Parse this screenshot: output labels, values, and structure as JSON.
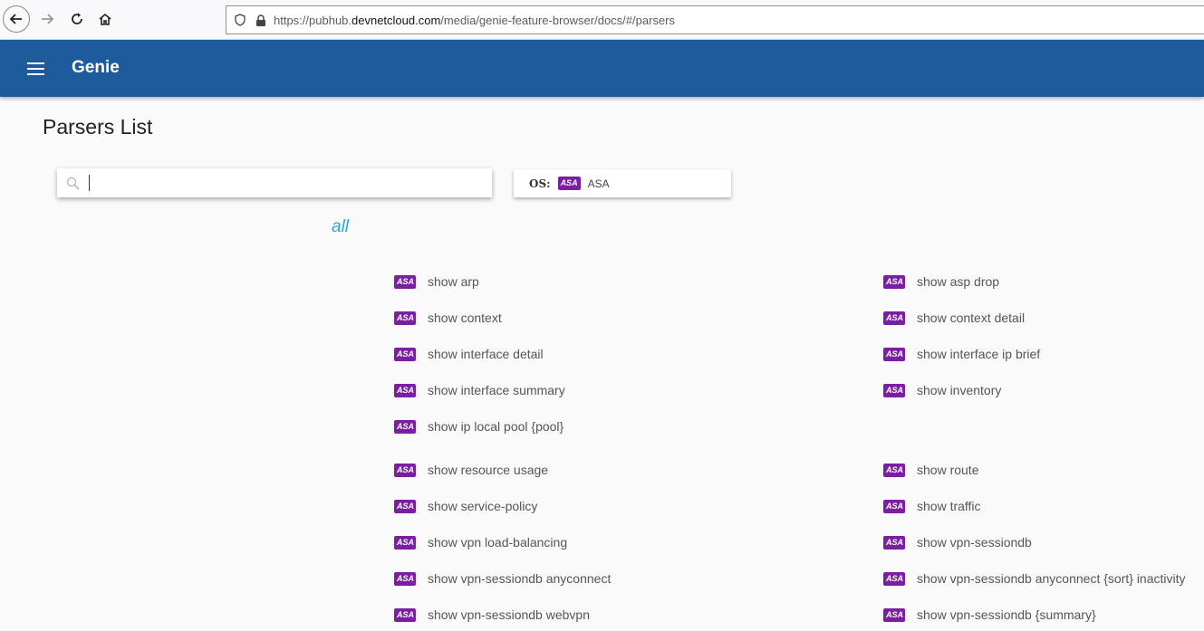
{
  "browser": {
    "url_prefix": "https://pubhub.",
    "url_domain": "devnetcloud.com",
    "url_path": "/media/genie-feature-browser/docs/#/parsers"
  },
  "app": {
    "title": "Genie",
    "page_title": "Parsers List"
  },
  "search": {
    "placeholder": ""
  },
  "os_filter": {
    "label": "OS:",
    "badge": "ASA",
    "value": "ASA"
  },
  "filter_link": "all",
  "badge_text": "ASA",
  "parsers_left": [
    "show arp",
    "show context",
    "show interface detail",
    "show interface summary",
    "show ip local pool {pool}",
    "show resource usage",
    "show service-policy",
    "show vpn load-balancing",
    "show vpn-sessiondb anyconnect",
    "show vpn-sessiondb webvpn"
  ],
  "parsers_right": [
    "show asp drop",
    "show context detail",
    "show interface ip brief",
    "show inventory",
    "show route",
    "show traffic",
    "show vpn-sessiondb",
    "show vpn-sessiondb anyconnect {sort} inactivity",
    "show vpn-sessiondb {summary}"
  ],
  "colors": {
    "appbar": "#1e5b9c",
    "badge": "#7b1fa2",
    "link": "#29a8d8"
  }
}
